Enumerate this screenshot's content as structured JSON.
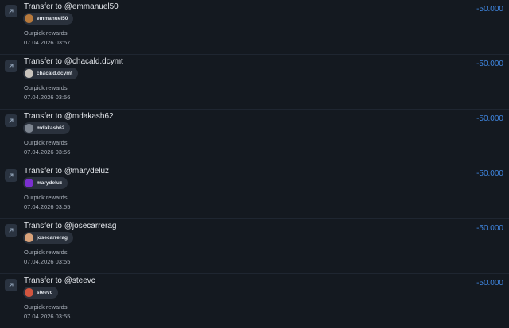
{
  "colors": {
    "background": "#141920",
    "amount": "#3f86e0",
    "chip_bg": "#2a313c",
    "icon_bg": "#2a3340"
  },
  "transactions": [
    {
      "icon": "arrow-up-right-icon",
      "title": "Transfer to @emmanuel50",
      "user": "emmanuel50",
      "avatar_color": "#b7793c",
      "memo": "Ourpick rewards",
      "time": "07.04.2026 03:57",
      "amount": "-50.000"
    },
    {
      "icon": "arrow-up-right-icon",
      "title": "Transfer to @chacald.dcymt",
      "user": "chacald.dcymt",
      "avatar_color": "#c9c4bd",
      "memo": "Ourpick rewards",
      "time": "07.04.2026 03:56",
      "amount": "-50.000"
    },
    {
      "icon": "arrow-up-right-icon",
      "title": "Transfer to @mdakash62",
      "user": "mdakash62",
      "avatar_color": "#7d8590",
      "memo": "Ourpick rewards",
      "time": "07.04.2026 03:56",
      "amount": "-50.000"
    },
    {
      "icon": "arrow-up-right-icon",
      "title": "Transfer to @marydeluz",
      "user": "marydeluz",
      "avatar_color": "#7b2fd0",
      "memo": "Ourpick rewards",
      "time": "07.04.2026 03:55",
      "amount": "-50.000"
    },
    {
      "icon": "arrow-up-right-icon",
      "title": "Transfer to @josecarrerag",
      "user": "josecarrerag",
      "avatar_color": "#d9a27a",
      "memo": "Ourpick rewards",
      "time": "07.04.2026 03:55",
      "amount": "-50.000"
    },
    {
      "icon": "arrow-up-right-icon",
      "title": "Transfer to @steevc",
      "user": "steevc",
      "avatar_color": "#d2553f",
      "memo": "Ourpick rewards",
      "time": "07.04.2026 03:55",
      "amount": "-50.000"
    }
  ]
}
